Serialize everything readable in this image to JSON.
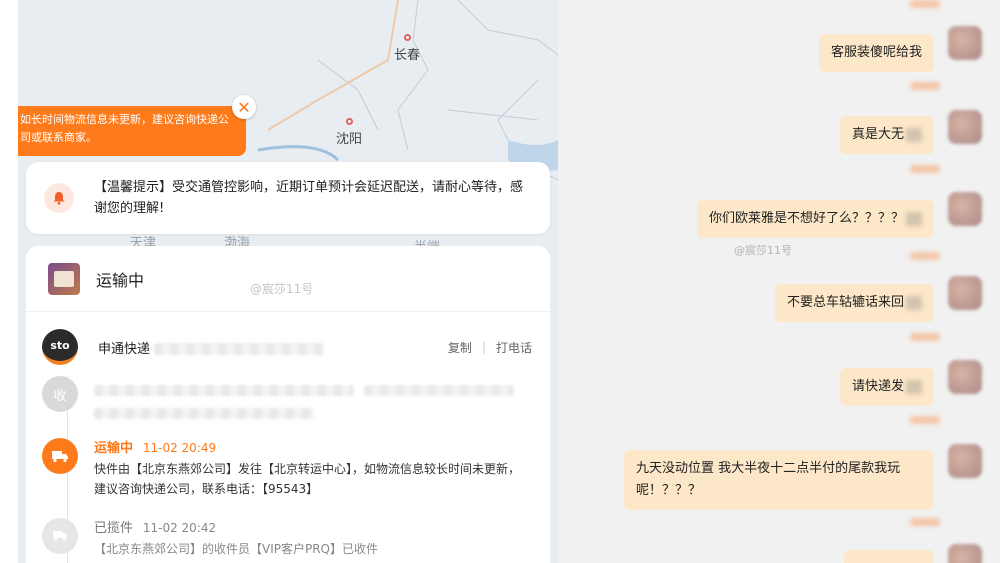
{
  "map": {
    "cities": {
      "changchun": "长春",
      "shenyang": "沈阳",
      "tianjin": "天津",
      "bohai": "渤海",
      "bandao": "半端"
    }
  },
  "toast": {
    "text": "如长时间物流信息未更新，建议咨询快递公司或联系商家。",
    "close": "✕"
  },
  "notice": {
    "text": "【温馨提示】受交通管控影响，近期订单预计会延迟配送，请耐心等待，感谢您的理解!"
  },
  "panel": {
    "status_title": "运输中",
    "watermark": "@宸莎11号",
    "carrier": {
      "logo": "sto",
      "name": "申通快递",
      "copy_label": "复制",
      "call_label": "打电话"
    },
    "timeline": {
      "receiver_badge": "收",
      "events": [
        {
          "status": "运输中",
          "time": "11-02 20:49",
          "detail": "快件由【北京东燕郊公司】发往【北京转运中心】，如物流信息较长时间未更新，建议咨询快递公司，联系电话：【95543】"
        },
        {
          "status": "已揽件",
          "time": "11-02 20:42",
          "detail": "【北京东燕郊公司】的收件员【VIP客户PRQ】已收件"
        }
      ]
    }
  },
  "chat": {
    "watermark": "@宸莎11号",
    "messages": [
      {
        "text": "客服装傻呢给我"
      },
      {
        "text": "真是大无"
      },
      {
        "text": "你们欧莱雅是不想好了么？？？？"
      },
      {
        "text": "不要总车轱辘话来回"
      },
      {
        "text": "请快递发"
      },
      {
        "text": "九天没动位置 我大半夜十二点半付的尾款我玩呢！？？？"
      }
    ]
  },
  "colors": {
    "accent": "#ff7a1a",
    "bubble": "#fde7c9",
    "map_bg": "#e8edf2",
    "chat_bg": "#f1f1f1"
  },
  "icons": [
    "close-icon",
    "bell-icon",
    "package-icon",
    "sto-logo",
    "truck-icon",
    "pickup-icon"
  ]
}
